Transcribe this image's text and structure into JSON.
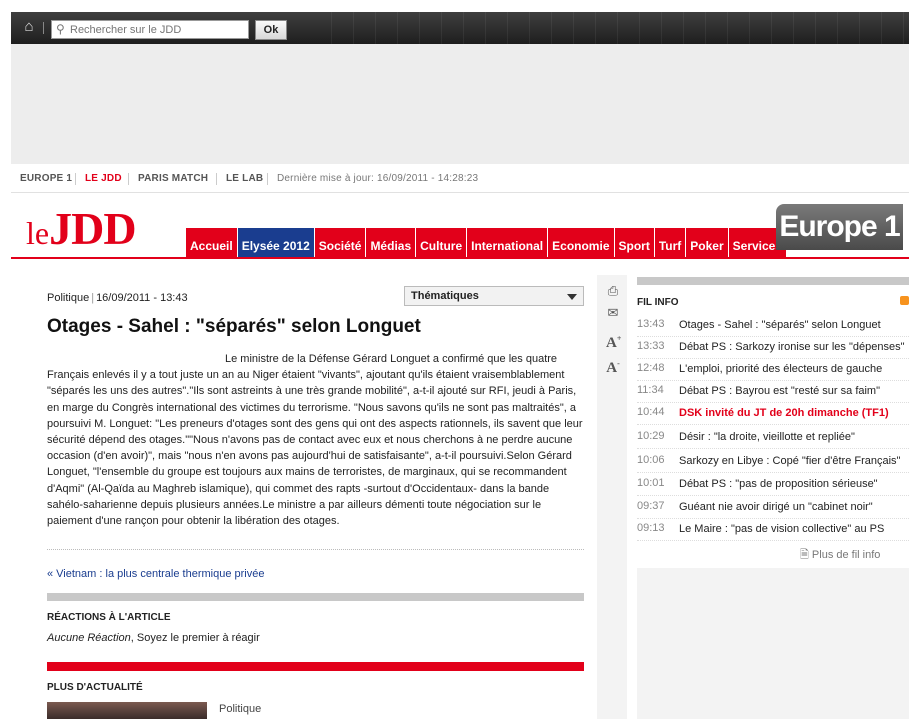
{
  "search": {
    "placeholder": "Rechercher sur le JDD",
    "button": "Ok"
  },
  "sites": {
    "items": [
      "EUROPE 1",
      "LE JDD",
      "PARIS MATCH",
      "LE LAB"
    ],
    "active_index": 1,
    "updated": "Dernière mise à jour: 16/09/2011 - 14:28:23"
  },
  "logo": {
    "le": "le",
    "jdd": "JDD"
  },
  "nav": [
    "Accueil",
    "Elysée 2012",
    "Société",
    "Médias",
    "Culture",
    "International",
    "Economie",
    "Sport",
    "Turf",
    "Poker",
    "Services"
  ],
  "europe1": "Europe 1",
  "article": {
    "category": "Politique",
    "date": "16/09/2011 - 13:43",
    "themes": "Thématiques",
    "title": "Otages - Sahel : \"séparés\" selon Longuet",
    "body": "Le ministre de la Défense Gérard Longuet a confirmé que les quatre Français enlevés il y a tout juste un an au Niger étaient \"vivants\", ajoutant qu'ils étaient vraisemblablement \"séparés les uns des autres\".\"Ils sont astreints à une très grande mobilité\", a-t-il ajouté sur RFI, jeudi à Paris, en marge du Congrès international des victimes du terrorisme. \"Nous savons qu'ils ne sont pas maltraités\", a poursuivi M. Longuet: \"Les preneurs d'otages sont des gens qui ont des aspects rationnels, ils savent que leur sécurité dépend des otages.\"\"Nous n'avons pas de contact avec eux et nous cherchons à ne perdre aucune occasion (d'en avoir)\", mais \"nous n'en avons pas aujourd'hui de satisfaisante\", a-t-il poursuivi.Selon Gérard Longuet, \"l'ensemble du groupe est toujours aux mains de terroristes, de marginaux, qui se recommandent d'Aqmi\" (Al-Qaïda au Maghreb islamique), qui commet des rapts -surtout d'Occidentaux- dans la bande sahélo-saharienne depuis plusieurs années.Le ministre a par ailleurs démenti toute négociation sur le paiement d'une rançon pour obtenir la libération des otages.",
    "prev_link": "« Vietnam : la plus centrale thermique privée"
  },
  "reactions": {
    "title": "RÉACTIONS À L'ARTICLE",
    "empty_italic": "Aucune Réaction",
    "empty_rest": ", Soyez le premier à réagir"
  },
  "more_news": {
    "title": "PLUS D'ACTUALITÉ",
    "category": "Politique"
  },
  "tools": {
    "font_up": "A",
    "font_down": "A",
    "plus": "+",
    "minus": "-"
  },
  "fil_info": {
    "title": "FIL INFO",
    "items": [
      {
        "time": "13:43",
        "text": "Otages - Sahel : \"séparés\" selon Longuet",
        "highlight": false
      },
      {
        "time": "13:33",
        "text": "Débat PS : Sarkozy ironise sur les \"dépenses\"",
        "highlight": false
      },
      {
        "time": "12:48",
        "text": "L'emploi, priorité des électeurs de gauche",
        "highlight": false
      },
      {
        "time": "11:34",
        "text": "Débat PS : Bayrou est \"resté sur sa faim\"",
        "highlight": false
      },
      {
        "time": "10:44",
        "text": "DSK invité du JT de 20h dimanche (TF1)",
        "highlight": true
      },
      {
        "time": "10:29",
        "text": "Désir : \"la droite, vieillotte et repliée\"",
        "highlight": false
      },
      {
        "time": "10:06",
        "text": "Sarkozy en Libye : Copé \"fier d'être Français\"",
        "highlight": false
      },
      {
        "time": "10:01",
        "text": "Débat PS : \"pas de proposition sérieuse\"",
        "highlight": false
      },
      {
        "time": "09:37",
        "text": "Guéant nie avoir dirigé un \"cabinet noir\"",
        "highlight": false
      },
      {
        "time": "09:13",
        "text": "Le Maire : \"pas de vision collective\" au PS",
        "highlight": false
      }
    ],
    "more": "Plus de fil info"
  }
}
